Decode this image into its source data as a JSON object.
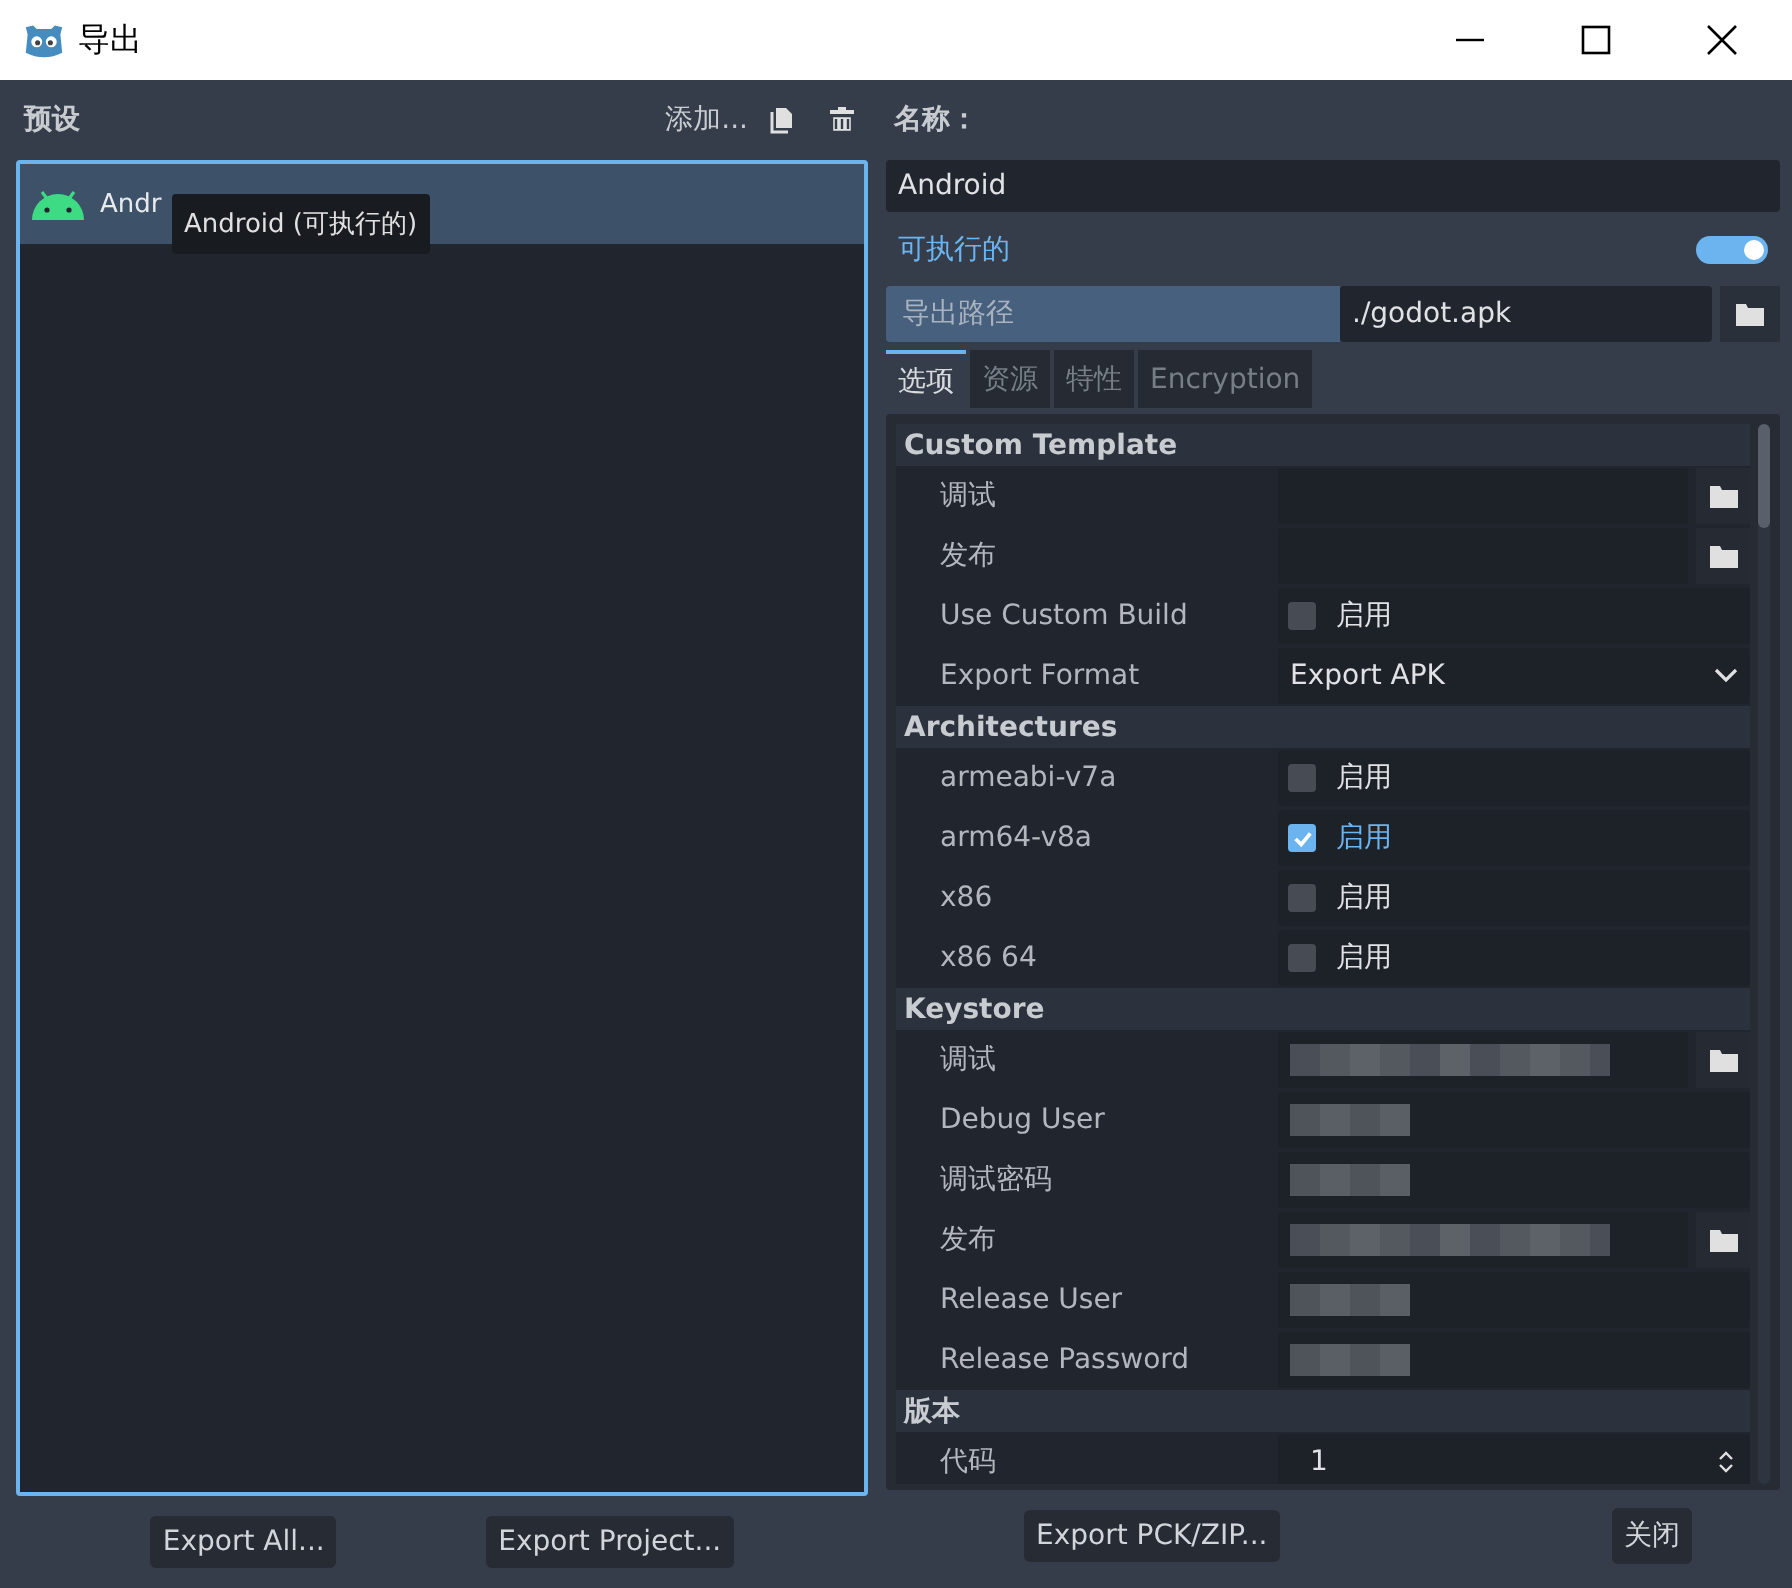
{
  "window": {
    "title": "导出"
  },
  "presets": {
    "title": "预设",
    "add_label": "添加...",
    "items": [
      {
        "label": "Andr",
        "selected": true
      }
    ],
    "tooltip": "Android (可执行的)"
  },
  "name": {
    "label": "名称：",
    "value": "Android"
  },
  "runnable": {
    "label": "可执行的",
    "on": true
  },
  "export_path": {
    "label": "导出路径",
    "value": "./godot.apk"
  },
  "tabs": [
    {
      "label": "选项",
      "selected": true
    },
    {
      "label": "资源",
      "selected": false
    },
    {
      "label": "特性",
      "selected": false
    },
    {
      "label": "Encryption",
      "selected": false
    }
  ],
  "options": [
    {
      "kind": "section",
      "label": "Custom Template"
    },
    {
      "kind": "file",
      "label": "调试"
    },
    {
      "kind": "file",
      "label": "发布"
    },
    {
      "kind": "checkbox",
      "label": "Use Custom Build",
      "checked": false,
      "check_label": "启用"
    },
    {
      "kind": "dropdown",
      "label": "Export Format",
      "value": "Export APK"
    },
    {
      "kind": "section",
      "label": "Architectures"
    },
    {
      "kind": "checkbox",
      "label": "armeabi-v7a",
      "checked": false,
      "check_label": "启用"
    },
    {
      "kind": "checkbox",
      "label": "arm64-v8a",
      "checked": true,
      "check_label": "启用"
    },
    {
      "kind": "checkbox",
      "label": "x86",
      "checked": false,
      "check_label": "启用"
    },
    {
      "kind": "checkbox",
      "label": "x86 64",
      "checked": false,
      "check_label": "启用"
    },
    {
      "kind": "section",
      "label": "Keystore"
    },
    {
      "kind": "hidden-file",
      "label": "调试"
    },
    {
      "kind": "hidden",
      "label": "Debug User"
    },
    {
      "kind": "hidden",
      "label": "调试密码"
    },
    {
      "kind": "hidden-file",
      "label": "发布"
    },
    {
      "kind": "hidden",
      "label": "Release User"
    },
    {
      "kind": "hidden",
      "label": "Release Password"
    },
    {
      "kind": "section",
      "label": "版本"
    },
    {
      "kind": "number",
      "label": "代码",
      "value": "1"
    }
  ],
  "left_buttons": [
    {
      "label": "Export All..."
    },
    {
      "label": "Export Project..."
    }
  ],
  "right_buttons": [
    {
      "label": "Export PCK/ZIP..."
    },
    {
      "label": "关闭"
    }
  ]
}
